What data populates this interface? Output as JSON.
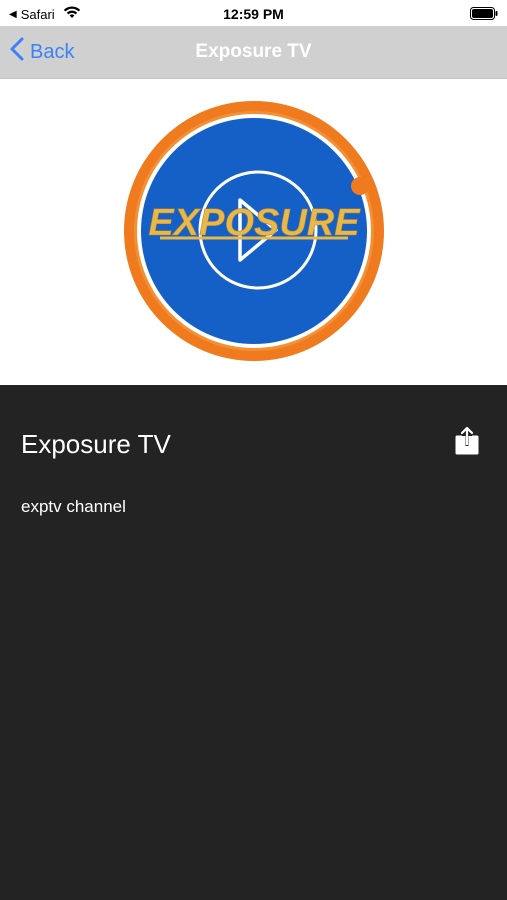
{
  "status_bar": {
    "back_indicator": "◀",
    "app": "Safari",
    "time": "12:59 PM"
  },
  "nav": {
    "back_label": "Back",
    "title": "Exposure TV"
  },
  "hero": {
    "logo_text": "EXPOSURE",
    "colors": {
      "ring": "#f07a1e",
      "disc": "#1560c7",
      "text": "#e8b84a"
    }
  },
  "channel": {
    "title": "Exposure TV",
    "description": "exptv channel"
  },
  "icons": {
    "wifi": "wifi-icon",
    "battery": "battery-icon",
    "back": "chevron-left-icon",
    "play": "play-icon",
    "share": "share-icon"
  }
}
